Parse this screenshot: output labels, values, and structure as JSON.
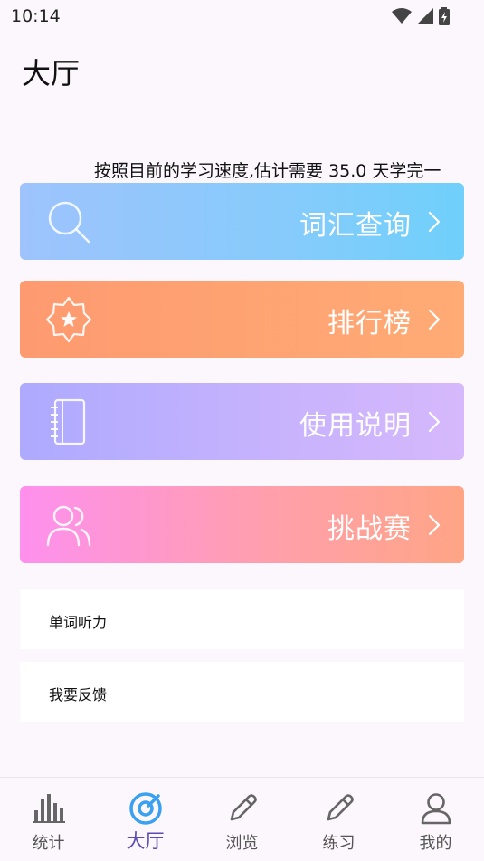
{
  "status_bar": {
    "time": "10:14"
  },
  "page": {
    "title": "大厅"
  },
  "ticker": {
    "text": "按照目前的学习速度,估计需要 35.0 天学完一"
  },
  "cards": [
    {
      "label": "词汇查询",
      "icon": "search-icon"
    },
    {
      "label": "排行榜",
      "icon": "star-badge-icon"
    },
    {
      "label": "使用说明",
      "icon": "notebook-icon"
    },
    {
      "label": "挑战赛",
      "icon": "users-icon"
    }
  ],
  "rows": [
    {
      "label": "单词听力"
    },
    {
      "label": "我要反馈"
    }
  ],
  "bottom_nav": [
    {
      "label": "统计",
      "icon": "bar-chart-icon",
      "active": false
    },
    {
      "label": "大厅",
      "icon": "hall-icon",
      "active": true
    },
    {
      "label": "浏览",
      "icon": "pencil-icon",
      "active": false
    },
    {
      "label": "练习",
      "icon": "pencil-icon",
      "active": false
    },
    {
      "label": "我的",
      "icon": "user-icon",
      "active": false
    }
  ],
  "colors": {
    "accent": "#5b4bb3",
    "background": "#fcf6fd"
  }
}
